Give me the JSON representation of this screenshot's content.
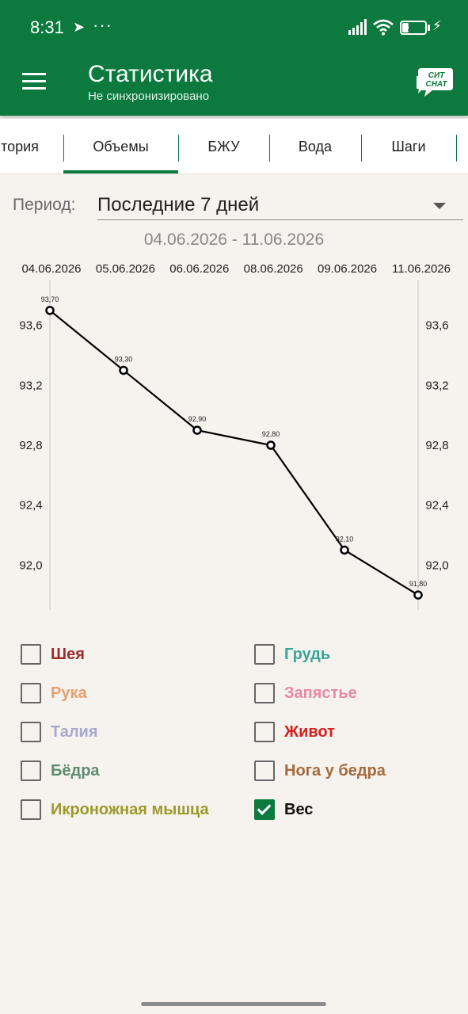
{
  "status_bar": {
    "time": "8:31",
    "extra_icons": "···",
    "battery_level": "29",
    "battery_fraction": 0.29,
    "icons": [
      "telegram-icon",
      "more-icon",
      "signal-icon",
      "wifi-icon",
      "battery-icon",
      "charging-icon"
    ]
  },
  "app_bar": {
    "title": "Статистика",
    "subtitle": "Не синхронизировано",
    "logo_text_top": "СИТ",
    "logo_text_bottom": "CHAT",
    "brand_color": "#0c7a3e"
  },
  "tabs": [
    {
      "label": "тория",
      "active": false
    },
    {
      "label": "Объемы",
      "active": true
    },
    {
      "label": "БЖУ",
      "active": false
    },
    {
      "label": "Вода",
      "active": false
    },
    {
      "label": "Шаги",
      "active": false
    }
  ],
  "period": {
    "label": "Период:",
    "selected": "Последние 7 дней",
    "date_range": "04.06.2026 - 11.06.2026"
  },
  "chart_data": {
    "type": "line",
    "x": [
      "04.06.2026",
      "05.06.2026",
      "06.06.2026",
      "08.06.2026",
      "09.06.2026",
      "11.06.2026"
    ],
    "series": [
      {
        "values": [
          93.7,
          93.3,
          92.9,
          92.8,
          92.1,
          91.8
        ],
        "point_labels": [
          "93,70",
          "93,30",
          "92,90",
          "92,80",
          "92,10",
          "91,80"
        ],
        "color": "#000000"
      }
    ],
    "yticks": [
      "93,6",
      "93,2",
      "92,8",
      "92,4",
      "92,0"
    ],
    "ytick_values": [
      93.6,
      93.2,
      92.8,
      92.4,
      92.0
    ],
    "ylim": [
      91.7,
      93.9
    ],
    "dual_y_axis": true,
    "grid": false
  },
  "checkboxes": [
    {
      "label": "Шея",
      "color": "#9b2c2c",
      "checked": false
    },
    {
      "label": "Грудь",
      "color": "#3aa699",
      "checked": false
    },
    {
      "label": "Рука",
      "color": "#e3a070",
      "checked": false
    },
    {
      "label": "Запястье",
      "color": "#e889a6",
      "checked": false
    },
    {
      "label": "Талия",
      "color": "#a9a8cf",
      "checked": false
    },
    {
      "label": "Живот",
      "color": "#d32020",
      "checked": false
    },
    {
      "label": "Бёдра",
      "color": "#5f8c6f",
      "checked": false
    },
    {
      "label": "Нога у бедра",
      "color": "#a66a3c",
      "checked": false
    },
    {
      "label": "Икроножная мышца",
      "color": "#9a9a2c",
      "checked": false
    },
    {
      "label": "Вес",
      "color": "#111111",
      "checked": true
    }
  ]
}
